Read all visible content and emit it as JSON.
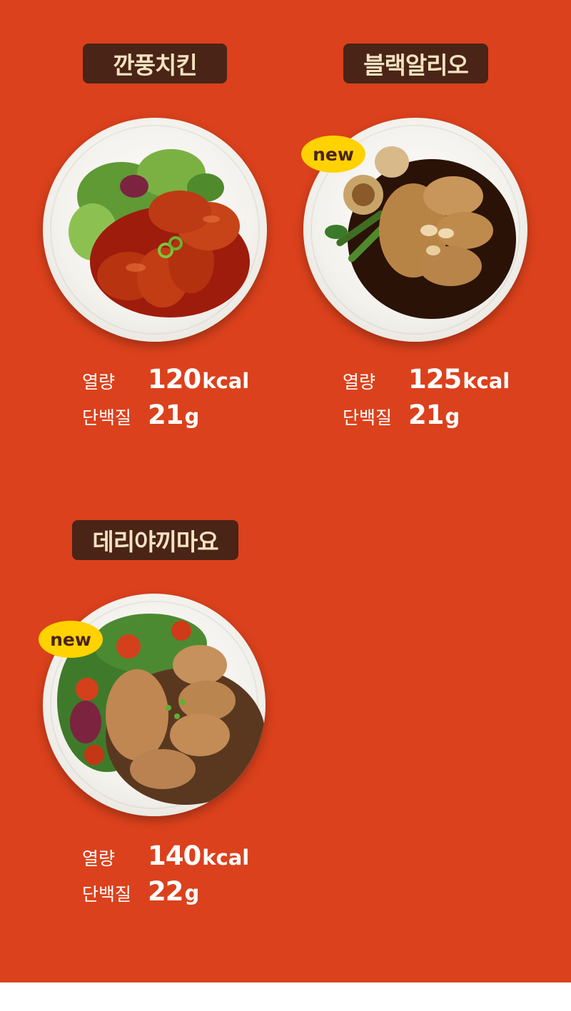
{
  "products": [
    {
      "name": "깐풍치킨",
      "calorie_label": "열량",
      "calorie_value": "120",
      "calorie_unit": "kcal",
      "protein_label": "단백질",
      "protein_value": "21",
      "protein_unit": "g"
    },
    {
      "name": "블랙알리오",
      "badge": "new",
      "calorie_label": "열량",
      "calorie_value": "125",
      "calorie_unit": "kcal",
      "protein_label": "단백질",
      "protein_value": "21",
      "protein_unit": "g"
    },
    {
      "name": "데리야끼마요",
      "badge": "new",
      "calorie_label": "열량",
      "calorie_value": "140",
      "calorie_unit": "kcal",
      "protein_label": "단백질",
      "protein_value": "22",
      "protein_unit": "g"
    }
  ],
  "colors": {
    "background": "#db411c",
    "title_badge_bg": "#4a2416",
    "title_badge_text": "#f4e2c1",
    "new_badge": "#ffd200"
  }
}
